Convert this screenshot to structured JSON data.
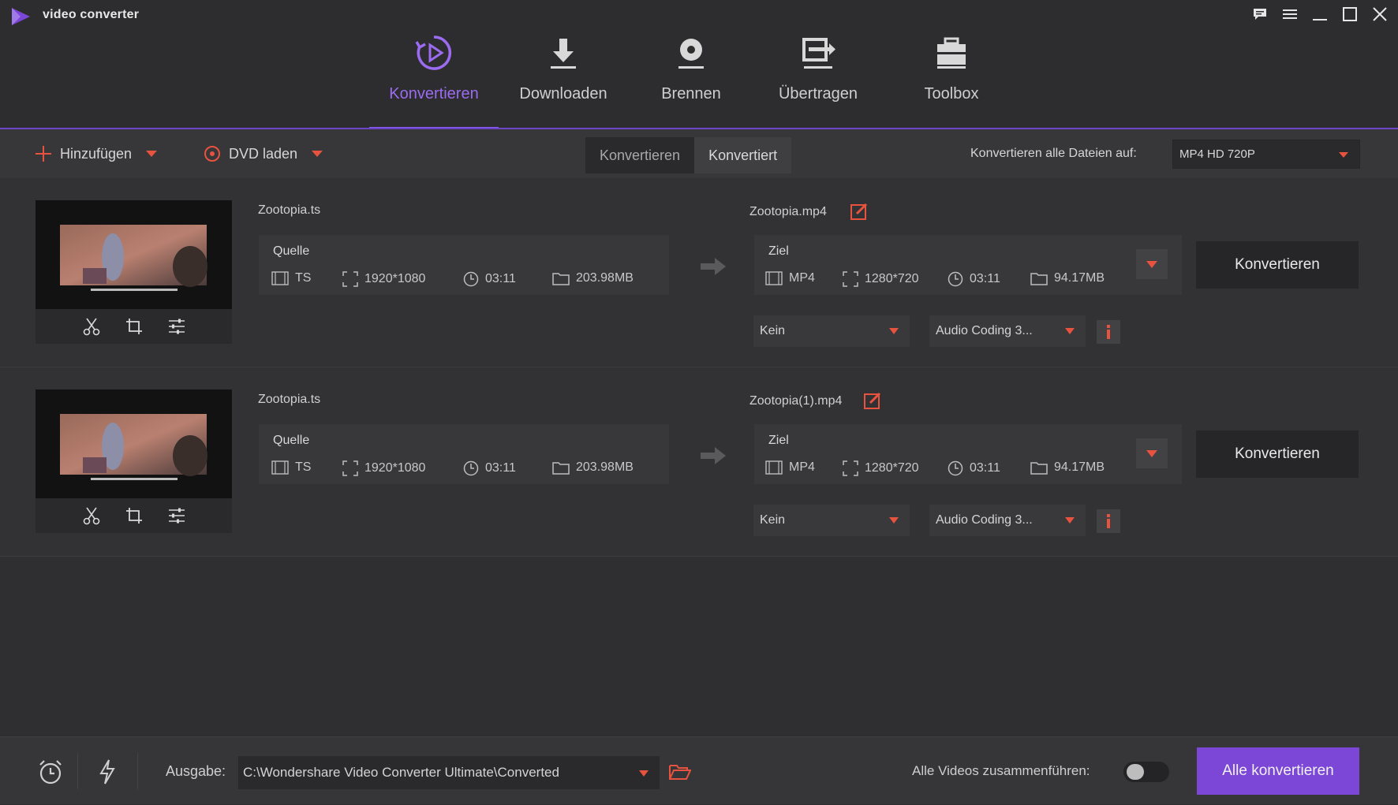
{
  "app": {
    "title": "video converter"
  },
  "window_controls": {
    "icons": [
      "feedback-icon",
      "menu-icon",
      "minimize-icon",
      "maximize-icon",
      "close-icon"
    ]
  },
  "nav": {
    "items": [
      {
        "label": "Konvertieren",
        "icon": "convert-icon",
        "active": true
      },
      {
        "label": "Downloaden",
        "icon": "download-icon",
        "active": false
      },
      {
        "label": "Brennen",
        "icon": "burn-icon",
        "active": false
      },
      {
        "label": "Übertragen",
        "icon": "transfer-icon",
        "active": false
      },
      {
        "label": "Toolbox",
        "icon": "toolbox-icon",
        "active": false
      }
    ]
  },
  "toolbar": {
    "add_label": "Hinzufügen",
    "dvd_label": "DVD laden",
    "tabs": [
      {
        "label": "Konvertieren",
        "active": true
      },
      {
        "label": "Konvertiert",
        "active": false
      }
    ],
    "format_label": "Konvertieren alle Dateien auf:",
    "format_value": "MP4 HD 720P"
  },
  "files": [
    {
      "source_name": "Zootopia.ts",
      "source": {
        "caption": "Quelle",
        "format": "TS",
        "resolution": "1920*1080",
        "duration": "03:11",
        "size": "203.98MB"
      },
      "target_name": "Zootopia.mp4",
      "target": {
        "caption": "Ziel",
        "format": "MP4",
        "resolution": "1280*720",
        "duration": "03:11",
        "size": "94.17MB"
      },
      "subtitle": "Kein",
      "audio": "Audio Coding 3...",
      "convert_label": "Konvertieren"
    },
    {
      "source_name": "Zootopia.ts",
      "source": {
        "caption": "Quelle",
        "format": "TS",
        "resolution": "1920*1080",
        "duration": "03:11",
        "size": "203.98MB"
      },
      "target_name": "Zootopia(1).mp4",
      "target": {
        "caption": "Ziel",
        "format": "MP4",
        "resolution": "1280*720",
        "duration": "03:11",
        "size": "94.17MB"
      },
      "subtitle": "Kein",
      "audio": "Audio Coding 3...",
      "convert_label": "Konvertieren"
    }
  ],
  "bottom": {
    "output_label": "Ausgabe:",
    "output_path": "C:\\Wondershare Video Converter Ultimate\\Converted",
    "merge_label": "Alle Videos zusammenführen:",
    "merge_enabled": false,
    "convert_all_label": "Alle konvertieren"
  },
  "colors": {
    "accent": "#8b5cf6",
    "accent_button": "#7c46d6",
    "warning": "#e8533f",
    "background": "#2e2d2f"
  }
}
